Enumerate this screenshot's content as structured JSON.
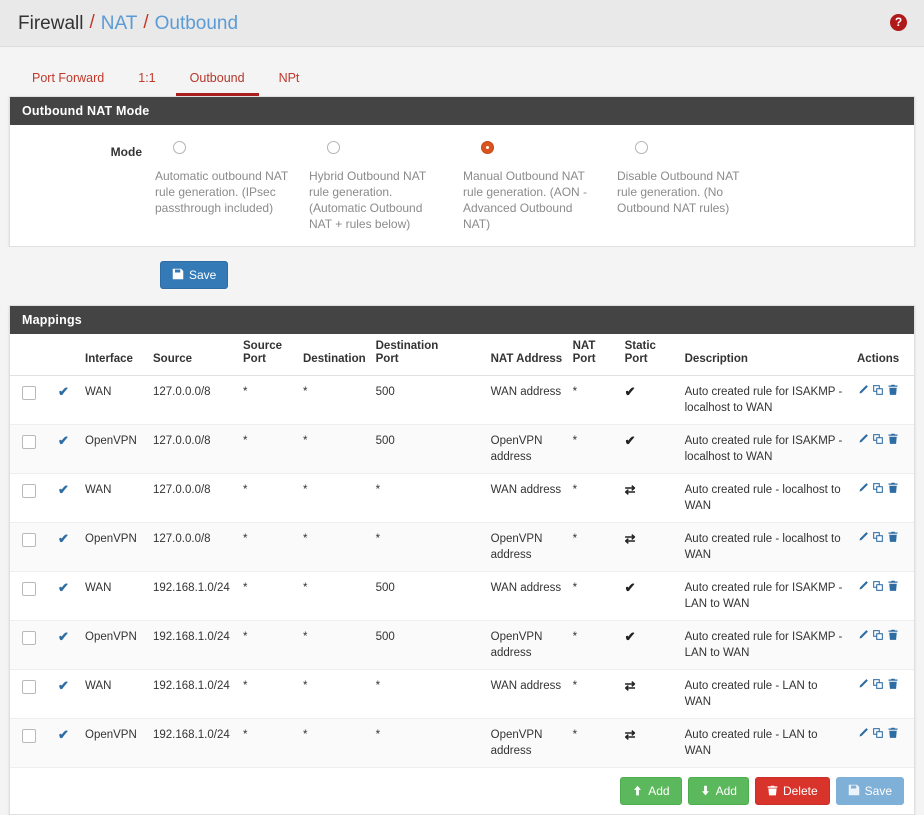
{
  "breadcrumb": {
    "root": "Firewall",
    "sep": "/",
    "section": "NAT",
    "page": "Outbound",
    "help_icon": "help-circle-icon",
    "help_glyph": "?"
  },
  "tabs": [
    {
      "label": "Port Forward",
      "active": false
    },
    {
      "label": "1:1",
      "active": false
    },
    {
      "label": "Outbound",
      "active": true
    },
    {
      "label": "NPt",
      "active": false
    }
  ],
  "mode_panel": {
    "title": "Outbound NAT Mode",
    "label": "Mode",
    "options": [
      {
        "selected": false,
        "desc": "Automatic outbound NAT rule generation.\n(IPsec passthrough included)"
      },
      {
        "selected": false,
        "desc": "Hybrid Outbound NAT rule generation.\n(Automatic Outbound NAT + rules below)"
      },
      {
        "selected": true,
        "desc": "Manual Outbound NAT rule generation.\n(AON - Advanced Outbound NAT)"
      },
      {
        "selected": false,
        "desc": "Disable Outbound NAT rule generation.\n(No Outbound NAT rules)"
      }
    ],
    "save_label": "Save",
    "save_icon": "floppy-disk-icon"
  },
  "mappings": {
    "title": "Mappings",
    "columns": [
      "",
      "",
      "Interface",
      "Source",
      "Source\nPort",
      "Destination",
      "Destination\nPort",
      "NAT Address",
      "NAT\nPort",
      "Static\nPort",
      "Description",
      "Actions"
    ],
    "rows": [
      {
        "enabled": true,
        "interface": "WAN",
        "source": "127.0.0.0/8",
        "source_port": "*",
        "destination": "*",
        "destination_port": "500",
        "nat_address": "WAN address",
        "nat_port": "*",
        "static_port": "check",
        "description": "Auto created rule for ISAKMP - localhost to WAN"
      },
      {
        "enabled": true,
        "interface": "OpenVPN",
        "source": "127.0.0.0/8",
        "source_port": "*",
        "destination": "*",
        "destination_port": "500",
        "nat_address": "OpenVPN address",
        "nat_port": "*",
        "static_port": "check",
        "description": "Auto created rule for ISAKMP - localhost to WAN"
      },
      {
        "enabled": true,
        "interface": "WAN",
        "source": "127.0.0.0/8",
        "source_port": "*",
        "destination": "*",
        "destination_port": "*",
        "nat_address": "WAN address",
        "nat_port": "*",
        "static_port": "random",
        "description": "Auto created rule - localhost to WAN"
      },
      {
        "enabled": true,
        "interface": "OpenVPN",
        "source": "127.0.0.0/8",
        "source_port": "*",
        "destination": "*",
        "destination_port": "*",
        "nat_address": "OpenVPN address",
        "nat_port": "*",
        "static_port": "random",
        "description": "Auto created rule - localhost to WAN"
      },
      {
        "enabled": true,
        "interface": "WAN",
        "source": "192.168.1.0/24",
        "source_port": "*",
        "destination": "*",
        "destination_port": "500",
        "nat_address": "WAN address",
        "nat_port": "*",
        "static_port": "check",
        "description": "Auto created rule for ISAKMP - LAN to WAN"
      },
      {
        "enabled": true,
        "interface": "OpenVPN",
        "source": "192.168.1.0/24",
        "source_port": "*",
        "destination": "*",
        "destination_port": "500",
        "nat_address": "OpenVPN address",
        "nat_port": "*",
        "static_port": "check",
        "description": "Auto created rule for ISAKMP - LAN to WAN"
      },
      {
        "enabled": true,
        "interface": "WAN",
        "source": "192.168.1.0/24",
        "source_port": "*",
        "destination": "*",
        "destination_port": "*",
        "nat_address": "WAN address",
        "nat_port": "*",
        "static_port": "random",
        "description": "Auto created rule - LAN to WAN"
      },
      {
        "enabled": true,
        "interface": "OpenVPN",
        "source": "192.168.1.0/24",
        "source_port": "*",
        "destination": "*",
        "destination_port": "*",
        "nat_address": "OpenVPN address",
        "nat_port": "*",
        "static_port": "random",
        "description": "Auto created rule - LAN to WAN"
      }
    ],
    "row_actions": [
      "edit-pencil-icon",
      "copy-icon",
      "trash-icon"
    ],
    "footer_buttons": [
      {
        "label": "Add",
        "icon": "arrow-up-icon",
        "style": "success"
      },
      {
        "label": "Add",
        "icon": "arrow-down-icon",
        "style": "success"
      },
      {
        "label": "Delete",
        "icon": "trash-icon",
        "style": "danger"
      },
      {
        "label": "Save",
        "icon": "floppy-disk-icon",
        "style": "primary-muted"
      }
    ]
  },
  "colors": {
    "accent_red": "#a91e1e",
    "link_blue": "#5b9bd5",
    "panel_header": "#444444",
    "radio_selected": "#d9541e",
    "primary": "#337ab7",
    "success": "#5cb85c",
    "danger": "#d9342b"
  }
}
